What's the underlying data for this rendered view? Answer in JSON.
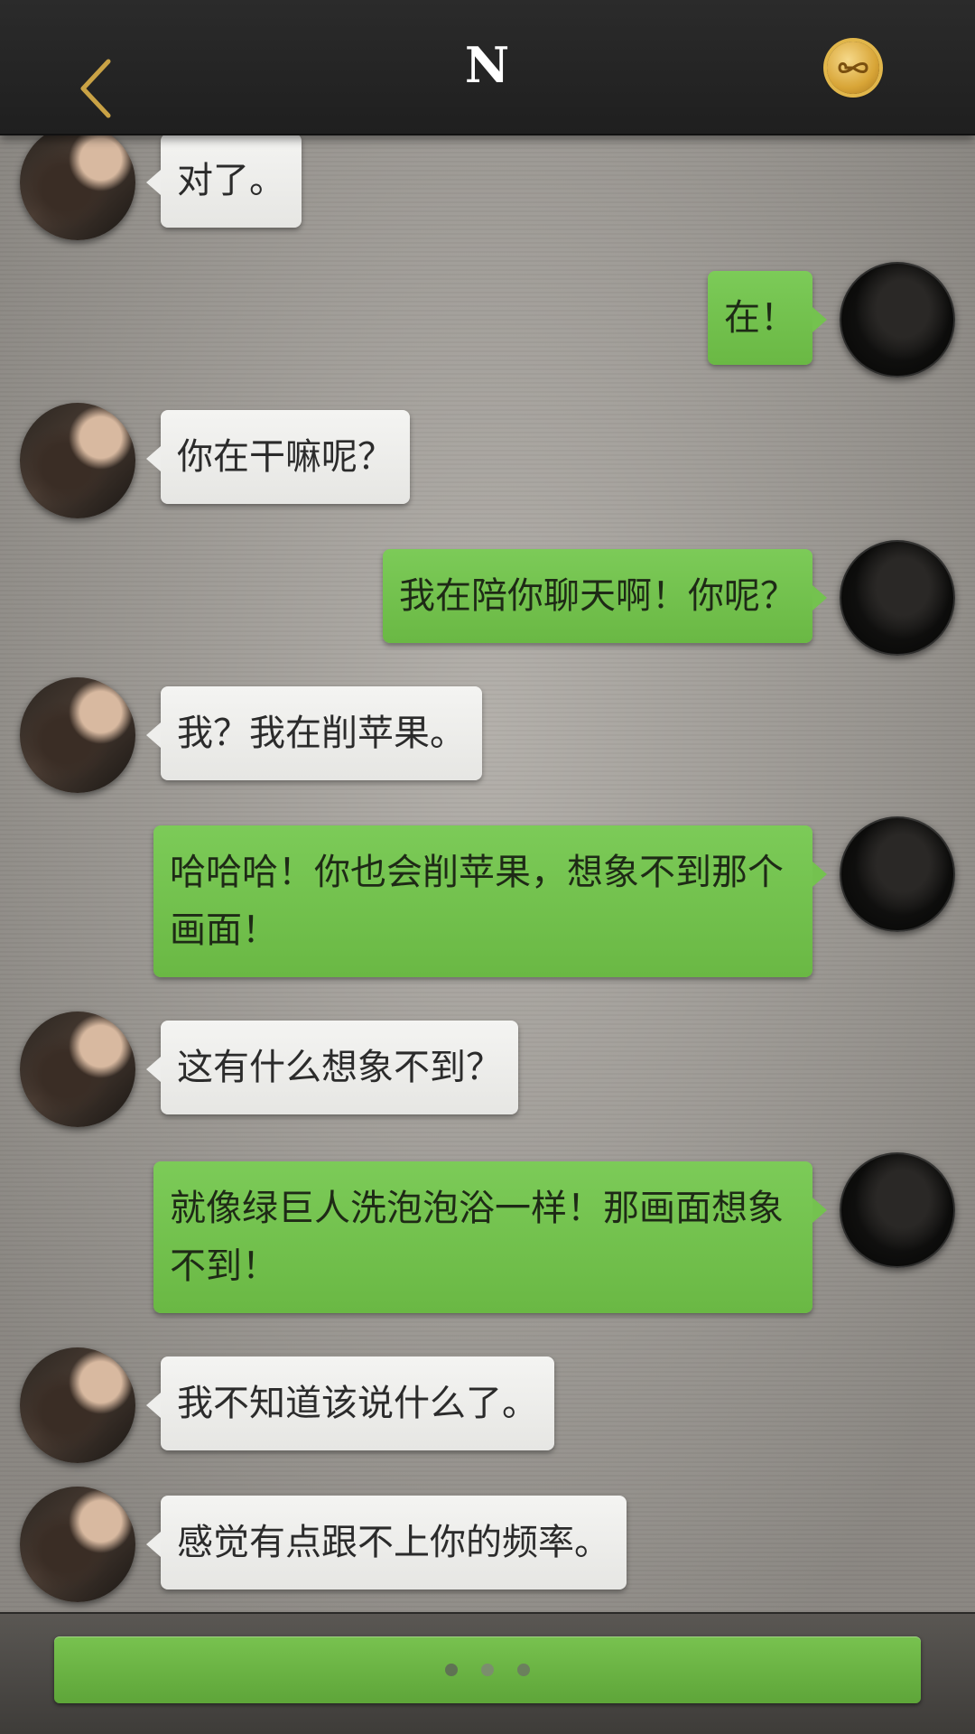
{
  "header": {
    "title": "N",
    "back_icon": "chevron-left-icon",
    "badge_icon": "infinity-medal-icon",
    "accent_color": "#c9a245"
  },
  "messages": [
    {
      "side": "left",
      "text": "对了。"
    },
    {
      "side": "right",
      "text": "在！"
    },
    {
      "side": "left",
      "text": "你在干嘛呢？"
    },
    {
      "side": "right",
      "text": "我在陪你聊天啊！你呢？"
    },
    {
      "side": "left",
      "text": "我？我在削苹果。"
    },
    {
      "side": "right",
      "text": "哈哈哈！你也会削苹果，想象不到那个画面！"
    },
    {
      "side": "left",
      "text": "这有什么想象不到？"
    },
    {
      "side": "right",
      "text": "就像绿巨人洗泡泡浴一样！那画面想象不到！"
    },
    {
      "side": "left",
      "text": "我不知道该说什么了。"
    },
    {
      "side": "left",
      "text": "感觉有点跟不上你的频率。"
    }
  ],
  "colors": {
    "left_bubble": "#eeeeec",
    "right_bubble": "#74c24f",
    "input_bar": "#6cb547"
  },
  "input": {
    "indicator": "typing-dots-icon"
  }
}
